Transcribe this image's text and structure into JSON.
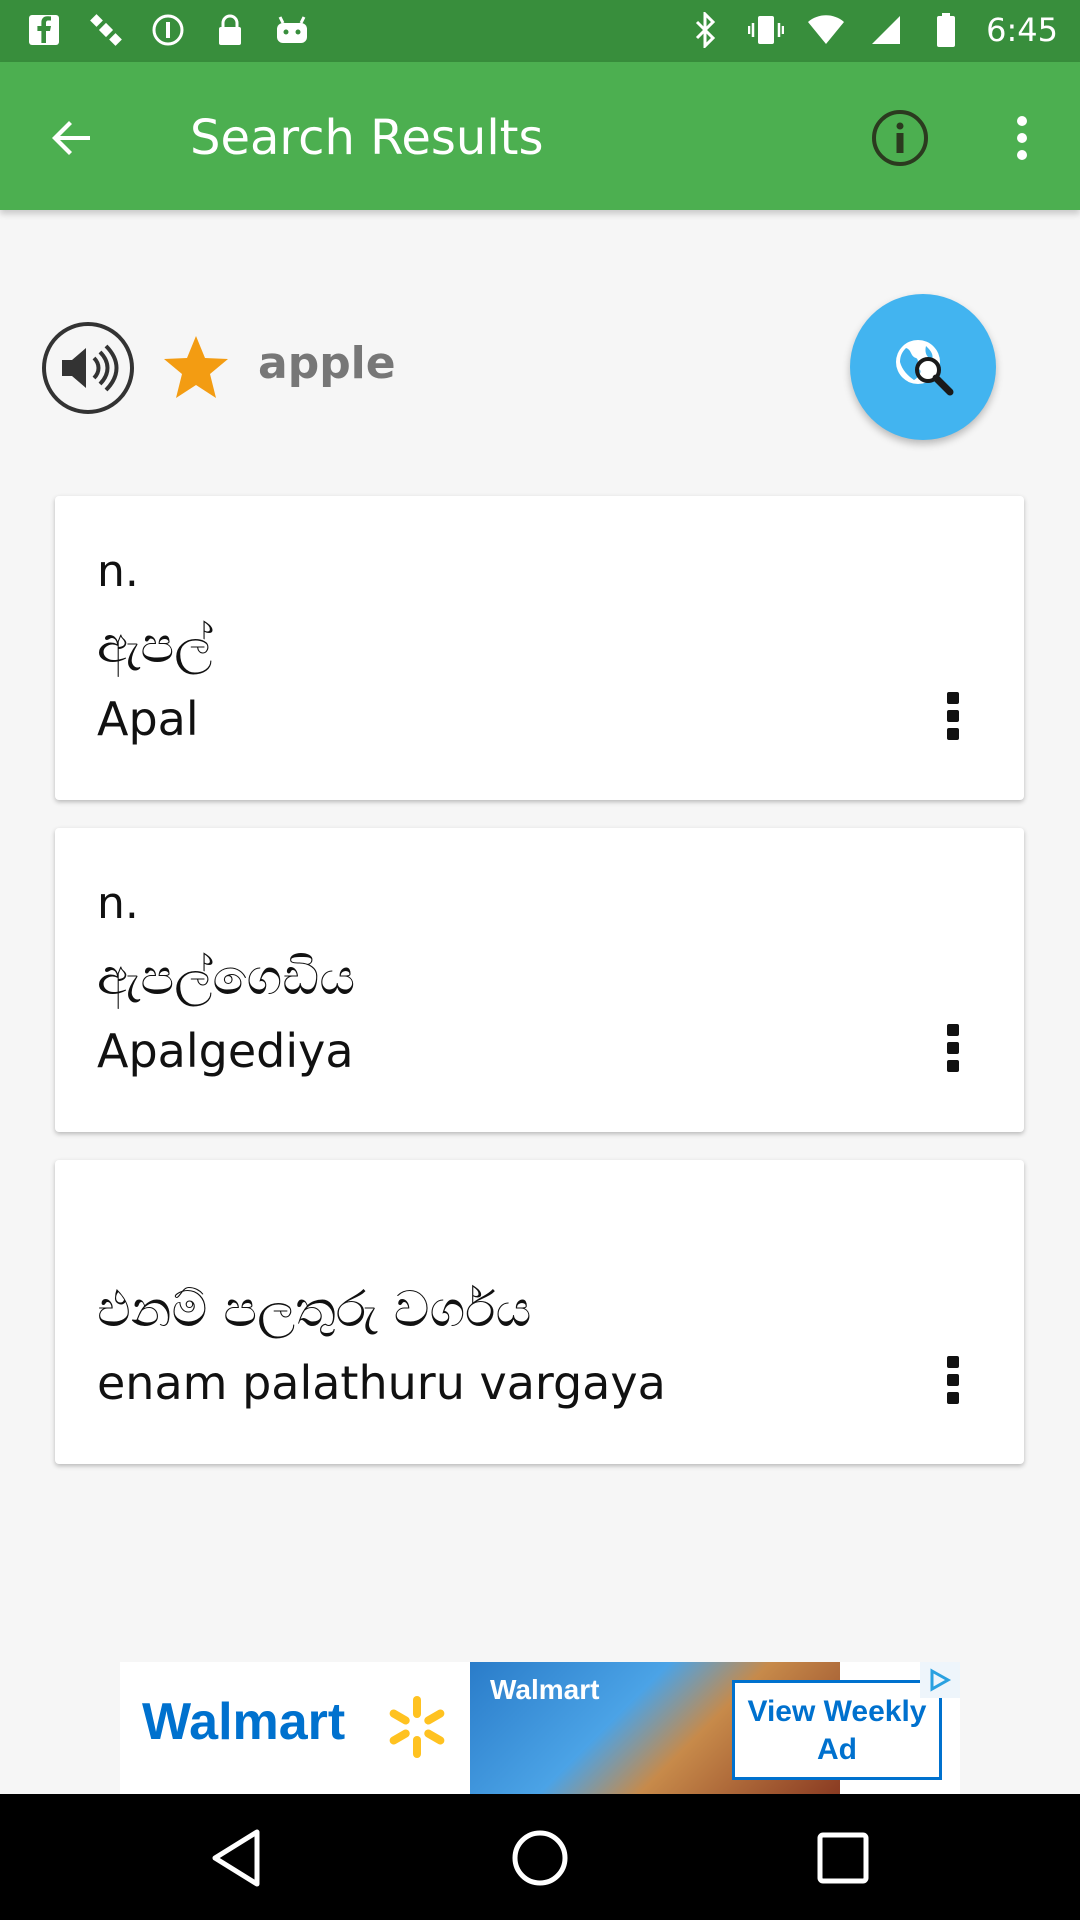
{
  "status_bar": {
    "time": "6:45",
    "left_icons": [
      "facebook-icon",
      "satellite-icon",
      "at-icon",
      "lock-icon",
      "android-icon"
    ],
    "right_icons": [
      "bluetooth-icon",
      "vibrate-icon",
      "wifi-icon",
      "signal-icon",
      "battery-icon"
    ]
  },
  "app_bar": {
    "title": "Search Results",
    "back_icon": "arrow-left-icon",
    "info_icon": "info-icon",
    "more_icon": "more-vert-icon",
    "color": "#4caf50"
  },
  "word": {
    "text": "apple",
    "speaker_icon": "speaker-icon",
    "favorite_icon": "star-icon",
    "search_fab_icon": "globe-search-icon",
    "star_color": "#f39c12",
    "fab_color": "#42b4f0"
  },
  "results": [
    {
      "pos": "n.",
      "sinhala": "ඇපල්",
      "transliteration": "Apal"
    },
    {
      "pos": "n.",
      "sinhala": "ඇපල්ගෙඩිය",
      "transliteration": "Apalgediya"
    },
    {
      "pos": "",
      "sinhala": "එනම් පලතුරු වර්ගය",
      "transliteration": "enam palathuru vargaya"
    }
  ],
  "ad": {
    "brand": "Walmart",
    "photo_text": "Walmart",
    "cta": "View Weekly Ad",
    "brand_color": "#0071ce"
  },
  "nav_bar": {
    "icons": [
      "back-triangle-icon",
      "home-circle-icon",
      "recents-square-icon"
    ]
  }
}
